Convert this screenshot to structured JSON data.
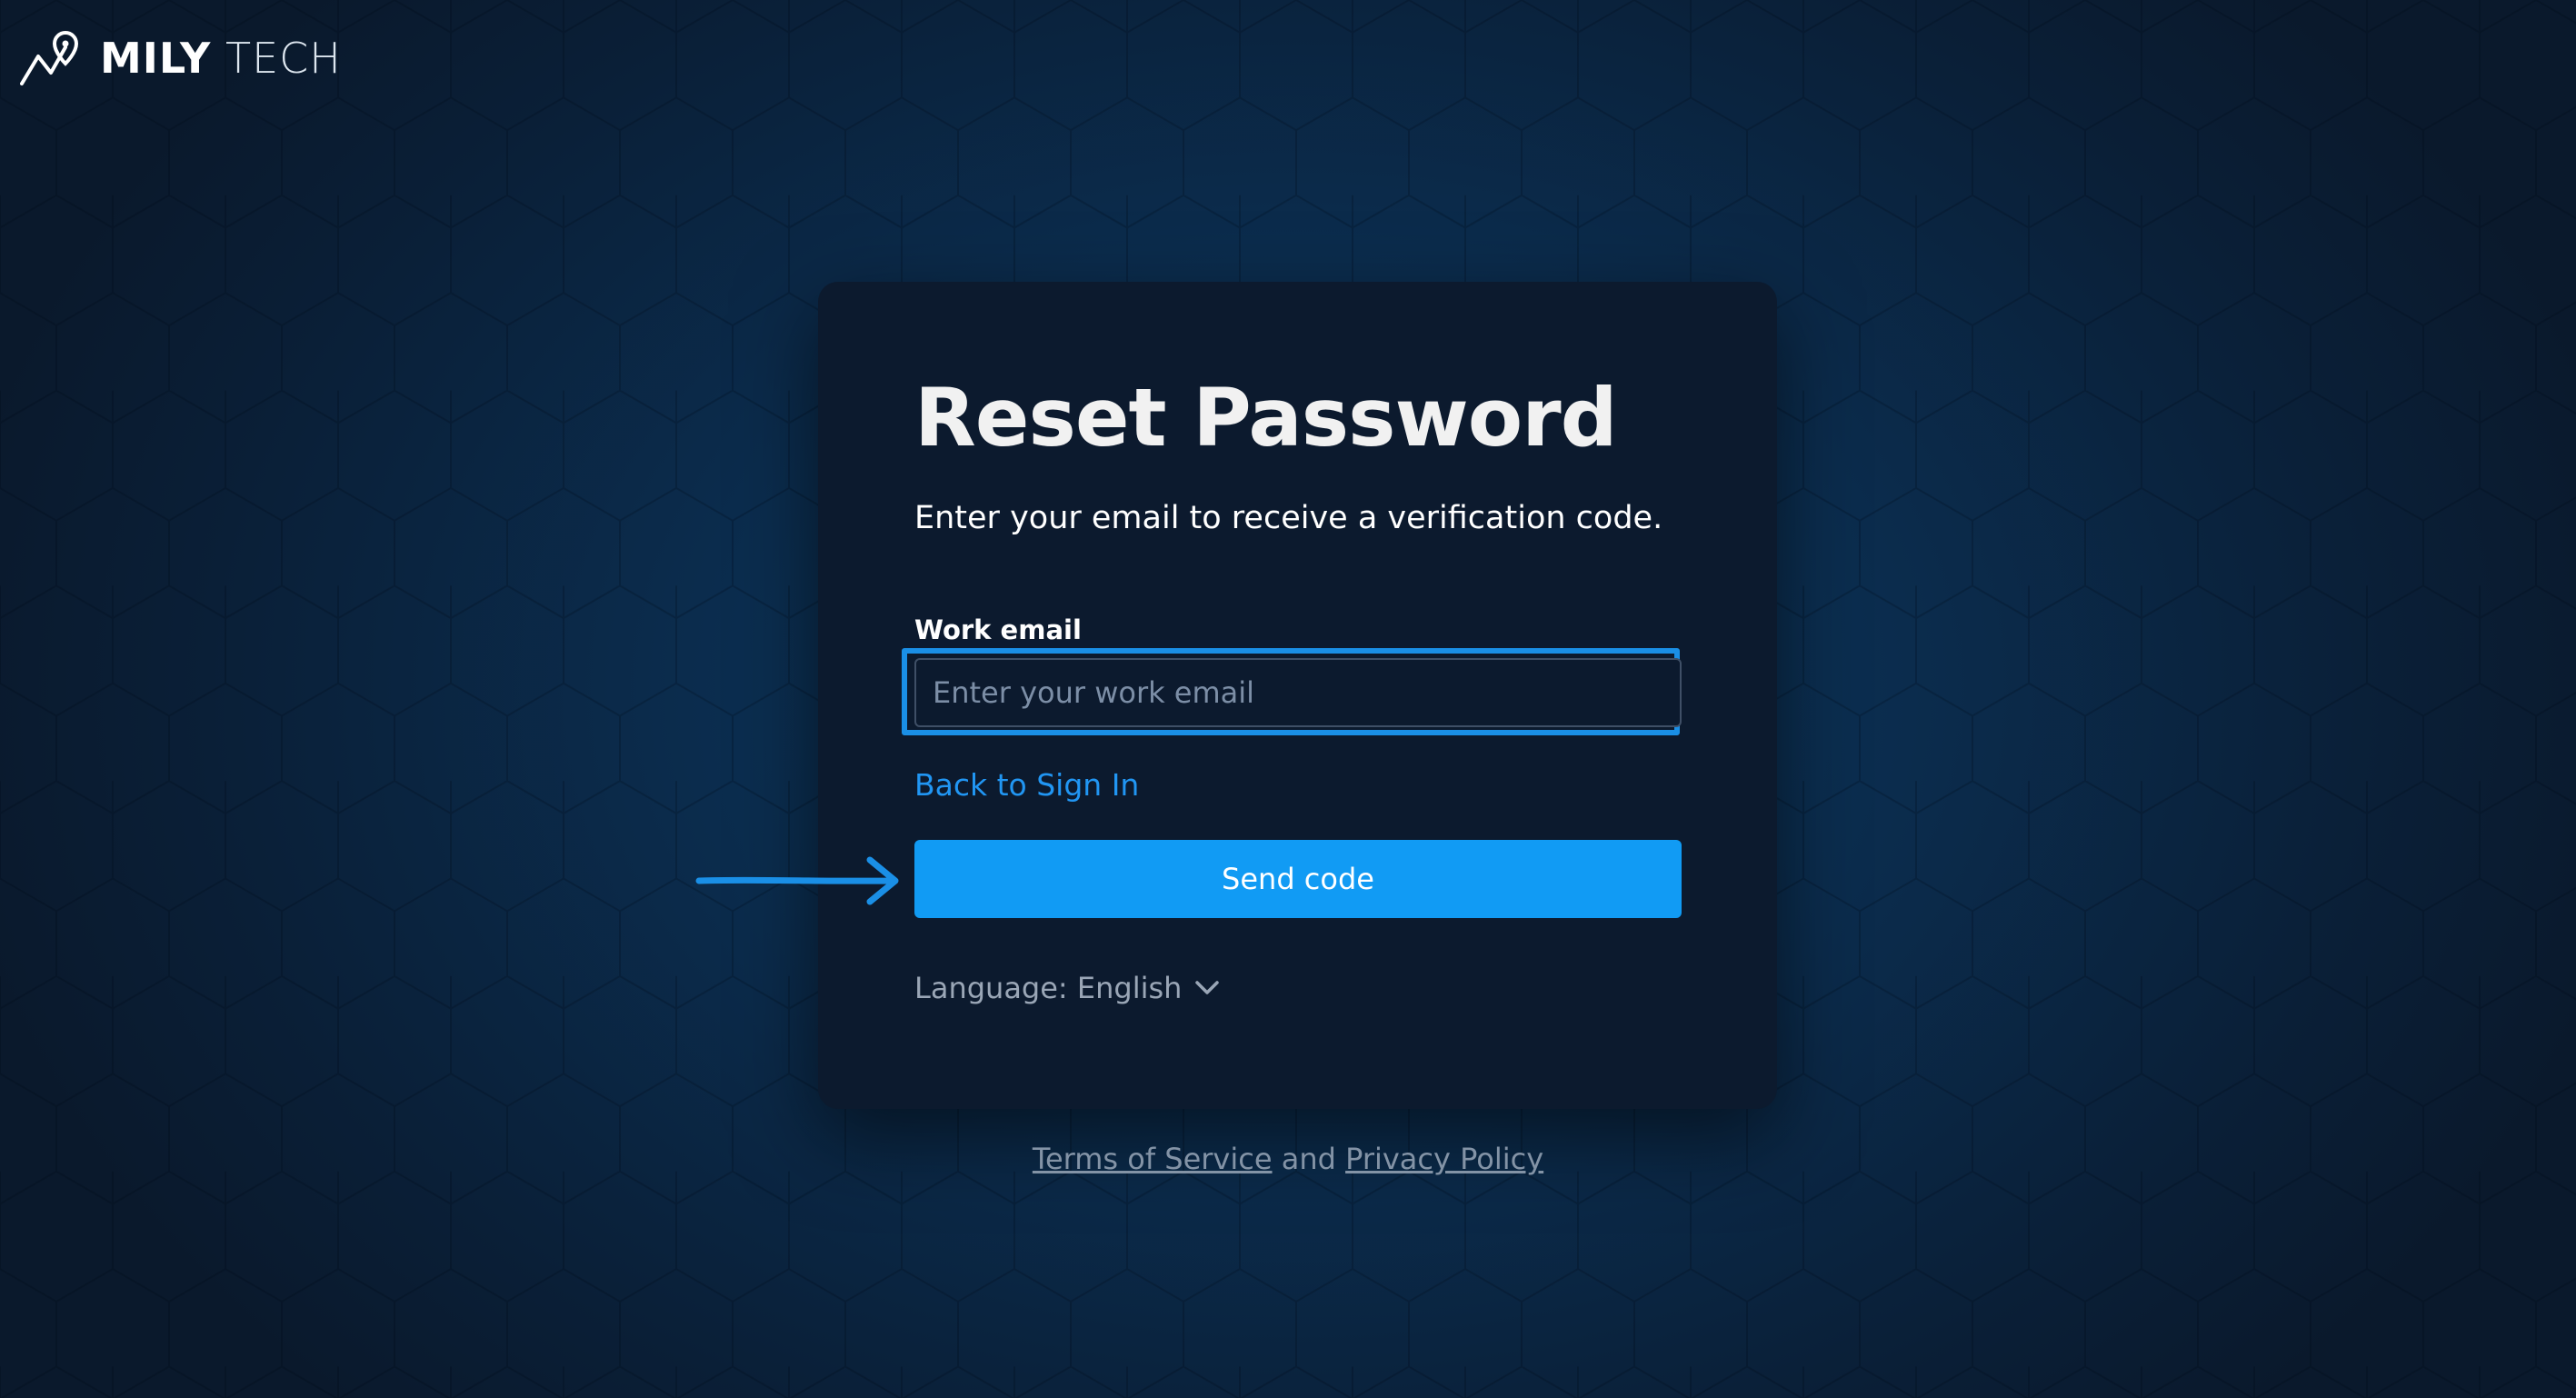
{
  "brand": {
    "name_bold": "MILY",
    "name_light": "TECH",
    "logo_icon": "mountain-pin-icon"
  },
  "card": {
    "title": "Reset Password",
    "subtitle": "Enter your email to receive a verification code.",
    "email_label": "Work email",
    "email_placeholder": "Enter your work email",
    "email_value": "",
    "back_link": "Back to Sign In",
    "send_button": "Send code",
    "language_label": "Language: English",
    "language_icon": "chevron-down-icon"
  },
  "footer": {
    "terms": "Terms of Service",
    "conjunction": "and",
    "privacy": "Privacy Policy"
  },
  "annotation": {
    "arrow_icon": "arrow-right-icon"
  },
  "colors": {
    "background": "#0b2c4d",
    "card": "#0c1a2e",
    "accent": "#119bf4",
    "focus_ring": "#1a8fe6",
    "link": "#2196f3",
    "muted_text": "#8393a6"
  }
}
